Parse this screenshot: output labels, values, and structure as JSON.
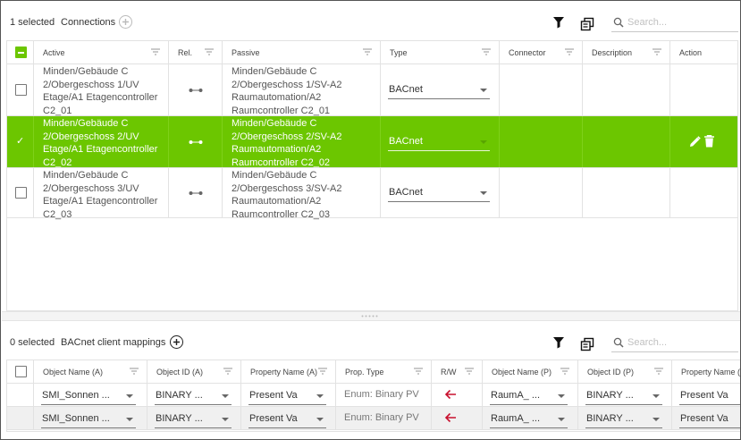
{
  "connections": {
    "selected_text": "1 selected",
    "title": "Connections",
    "add_icon": "plus-circle-icon",
    "search_placeholder": "Search...",
    "columns": [
      "Active",
      "Rel.",
      "Passive",
      "Type",
      "Connector",
      "Description",
      "Action"
    ],
    "rows": [
      {
        "active": [
          "Minden/Gebäude C",
          "2/Obergeschoss 1/UV",
          "Etage/A1 Etagencontroller",
          "C2_01"
        ],
        "passive": [
          "Minden/Gebäude C",
          "2/Obergeschoss 1/SV-A2",
          "Raumautomation/A2",
          "Raumcontroller C2_01"
        ],
        "type": "BACnet",
        "connector": "",
        "description": "",
        "selected": false
      },
      {
        "active": [
          "Minden/Gebäude C",
          "2/Obergeschoss 2/UV",
          "Etage/A1 Etagencontroller",
          "C2_02"
        ],
        "passive": [
          "Minden/Gebäude C",
          "2/Obergeschoss 2/SV-A2",
          "Raumautomation/A2",
          "Raumcontroller C2_02"
        ],
        "type": "BACnet",
        "connector": "",
        "description": "",
        "selected": true
      },
      {
        "active": [
          "Minden/Gebäude C",
          "2/Obergeschoss 3/UV",
          "Etage/A1 Etagencontroller",
          "C2_03"
        ],
        "passive": [
          "Minden/Gebäude C",
          "2/Obergeschoss 3/SV-A2",
          "Raumautomation/A2",
          "Raumcontroller C2_03"
        ],
        "type": "BACnet",
        "connector": "",
        "description": "",
        "selected": false
      }
    ]
  },
  "mappings": {
    "selected_text": "0 selected",
    "title": "BACnet client mappings",
    "search_placeholder": "Search...",
    "columns": [
      "Object Name (A)",
      "Object ID (A)",
      "Property Name (A)",
      "Prop. Type",
      "R/W",
      "Object Name (P)",
      "Object ID (P)",
      "Property Name (P)"
    ],
    "rows": [
      {
        "obj_name_a": "SMI_Sonnen ...",
        "obj_id_a": "BINARY ...",
        "prop_name_a": "Present Va",
        "prop_type": "Enum: Binary PV",
        "obj_name_p": "RaumA_ ...",
        "obj_id_p": "BINARY ...",
        "prop_name_p": "Present Va"
      },
      {
        "obj_name_a": "SMI_Sonnen ...",
        "obj_id_a": "BINARY ...",
        "prop_name_a": "Present Va",
        "prop_type": "Enum: Binary PV",
        "obj_name_p": "RaumA_ ...",
        "obj_id_p": "BINARY ...",
        "prop_name_p": "Present Va"
      }
    ]
  },
  "colors": {
    "accent": "#6cc600",
    "arrow": "#c8102e"
  }
}
